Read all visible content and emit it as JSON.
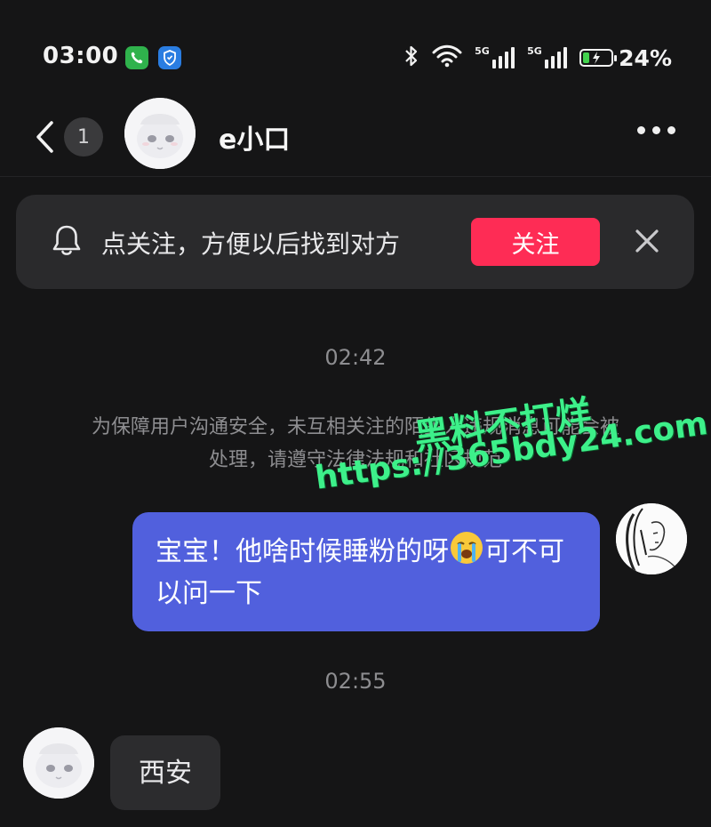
{
  "status_bar": {
    "time": "03:00",
    "signal_label_1": "5G",
    "signal_label_2": "5G",
    "battery_percent": "24%",
    "battery_level": 0.24
  },
  "header": {
    "unread_count": "1",
    "contact_name": "e小口"
  },
  "follow_banner": {
    "text": "点关注，方便以后找到对方",
    "button_label": "关注"
  },
  "chat": {
    "timestamp_1": "02:42",
    "system_notice": "为保障用户沟通安全，未互相关注的陌生人违规消息可能会被处理，请遵守法律法规和社区规范",
    "outgoing_message_before_emoji": "宝宝！他啥时候睡粉的呀",
    "outgoing_message_after_emoji": "可不可以问一下",
    "outgoing_emoji": "loudly-crying-face",
    "timestamp_2": "02:55",
    "incoming_message": "西安"
  },
  "watermark": {
    "line1": "黑料不打烊",
    "line2": "https://365bdy24.com"
  },
  "colors": {
    "background": "#151516",
    "outgoing_bubble": "#5160dd",
    "follow_button": "#fe2c55",
    "banner": "#2a2a2c",
    "watermark": "#3df08a"
  }
}
